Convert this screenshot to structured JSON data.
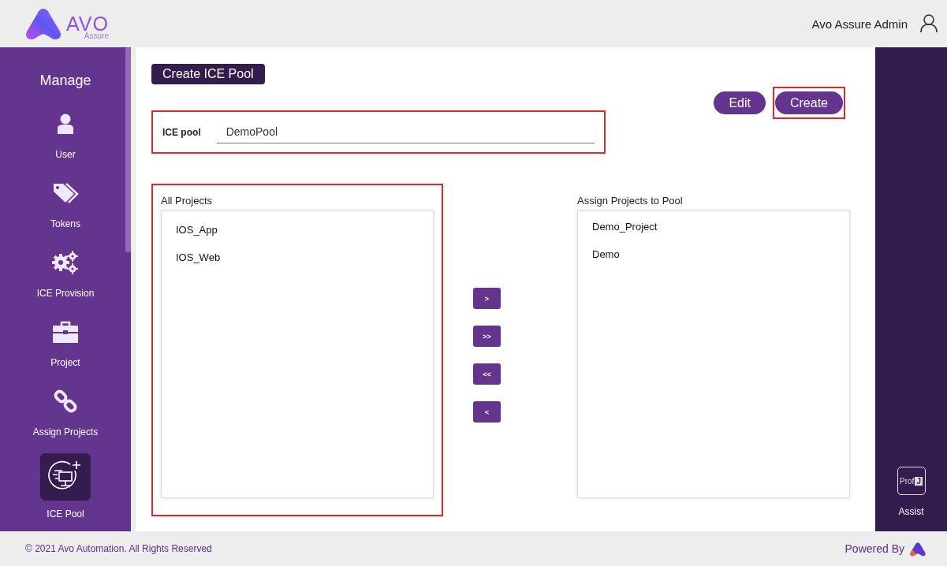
{
  "header": {
    "logo_text": "AVO",
    "logo_subtext": "Assure",
    "user_name": "Avo Assure Admin"
  },
  "sidebar": {
    "title": "Manage",
    "items": [
      {
        "label": "User",
        "kind": "user",
        "selected": false
      },
      {
        "label": "Tokens",
        "kind": "tokens",
        "selected": false
      },
      {
        "label": "ICE Provision",
        "kind": "gears",
        "selected": false
      },
      {
        "label": "Project",
        "kind": "briefcase",
        "selected": false
      },
      {
        "label": "Assign Projects",
        "kind": "link",
        "selected": false
      },
      {
        "label": "ICE Pool",
        "kind": "pool",
        "selected": true
      }
    ]
  },
  "main": {
    "title": "Create ICE Pool",
    "actions": [
      {
        "label": "Edit",
        "highlighted": false
      },
      {
        "label": "Create",
        "highlighted": true
      }
    ],
    "ice_pool": {
      "label": "ICE pool",
      "value": "DemoPool",
      "highlighted": true
    },
    "all_projects": {
      "title": "All Projects",
      "highlighted": true,
      "items": [
        "IOS_App",
        "IOS_Web"
      ]
    },
    "move_buttons": [
      ">",
      ">>",
      "<<",
      "<"
    ],
    "assigned_projects": {
      "title": "Assign Projects to Pool",
      "highlighted": false,
      "items": [
        "Demo_Project",
        "Demo"
      ]
    }
  },
  "assist": {
    "badge_text": "Prof",
    "badge_letter": "J",
    "label": "Assist"
  },
  "footer": {
    "copyright": "© 2021 Avo Automation. All Rights Reserved",
    "powered_by": "Powered By"
  }
}
